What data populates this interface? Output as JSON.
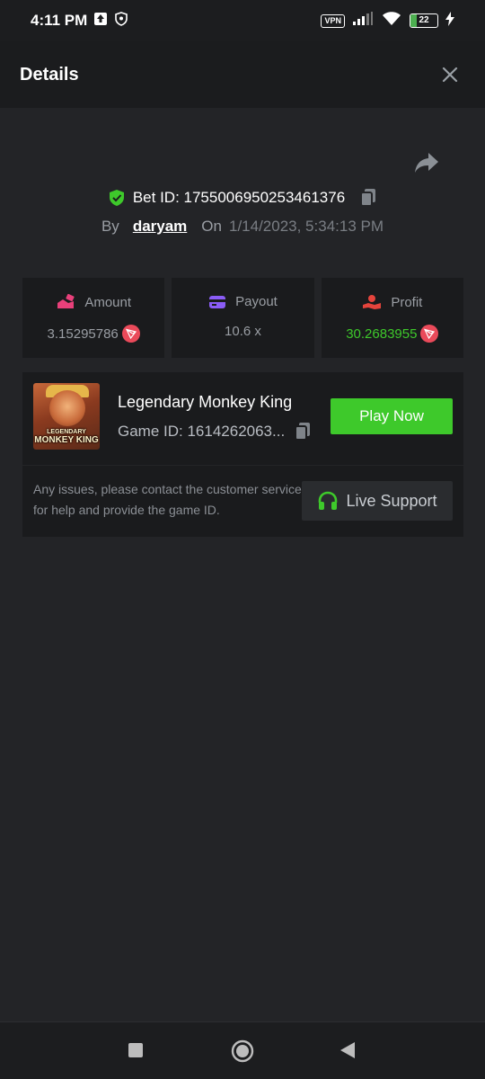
{
  "status_bar": {
    "time": "4:11 PM",
    "vpn": "VPN",
    "battery": "22",
    "battery_level": 0.22,
    "icons": [
      "upload-notification-icon",
      "shield-notification-icon",
      "vpn-icon",
      "signal-icon",
      "wifi-icon",
      "battery-icon",
      "charging-icon"
    ]
  },
  "header": {
    "title": "Details",
    "close_icon": "close-icon"
  },
  "bet": {
    "share_icon": "share-icon",
    "bet_id_label": "Bet ID: 1755006950253461376",
    "by_label": "By",
    "username": "daryam",
    "on_label": "On",
    "date": "1/14/2023, 5:34:13 PM"
  },
  "stats": {
    "amount": {
      "label": "Amount",
      "value": "3.15295786"
    },
    "payout": {
      "label": "Payout",
      "value": "10.6 x"
    },
    "profit": {
      "label": "Profit",
      "value": "30.2683955"
    }
  },
  "game": {
    "thumbnail_text_top": "LEGENDARY",
    "thumbnail_text": "MONKEY KING",
    "title": "Legendary Monkey King",
    "game_id": "Game ID: 1614262063...",
    "play_label": "Play Now",
    "help_text": "Any issues, please contact the customer service for help and provide the game ID.",
    "support_label": "Live Support"
  },
  "colors": {
    "background": "#232427",
    "card": "#1a1b1d",
    "accent_green": "#3ec92b",
    "coin_red": "#ea4a5a",
    "amount_icon": "#e8407a",
    "payout_icon": "#8a5cf6",
    "profit_icon": "#e5443c"
  }
}
